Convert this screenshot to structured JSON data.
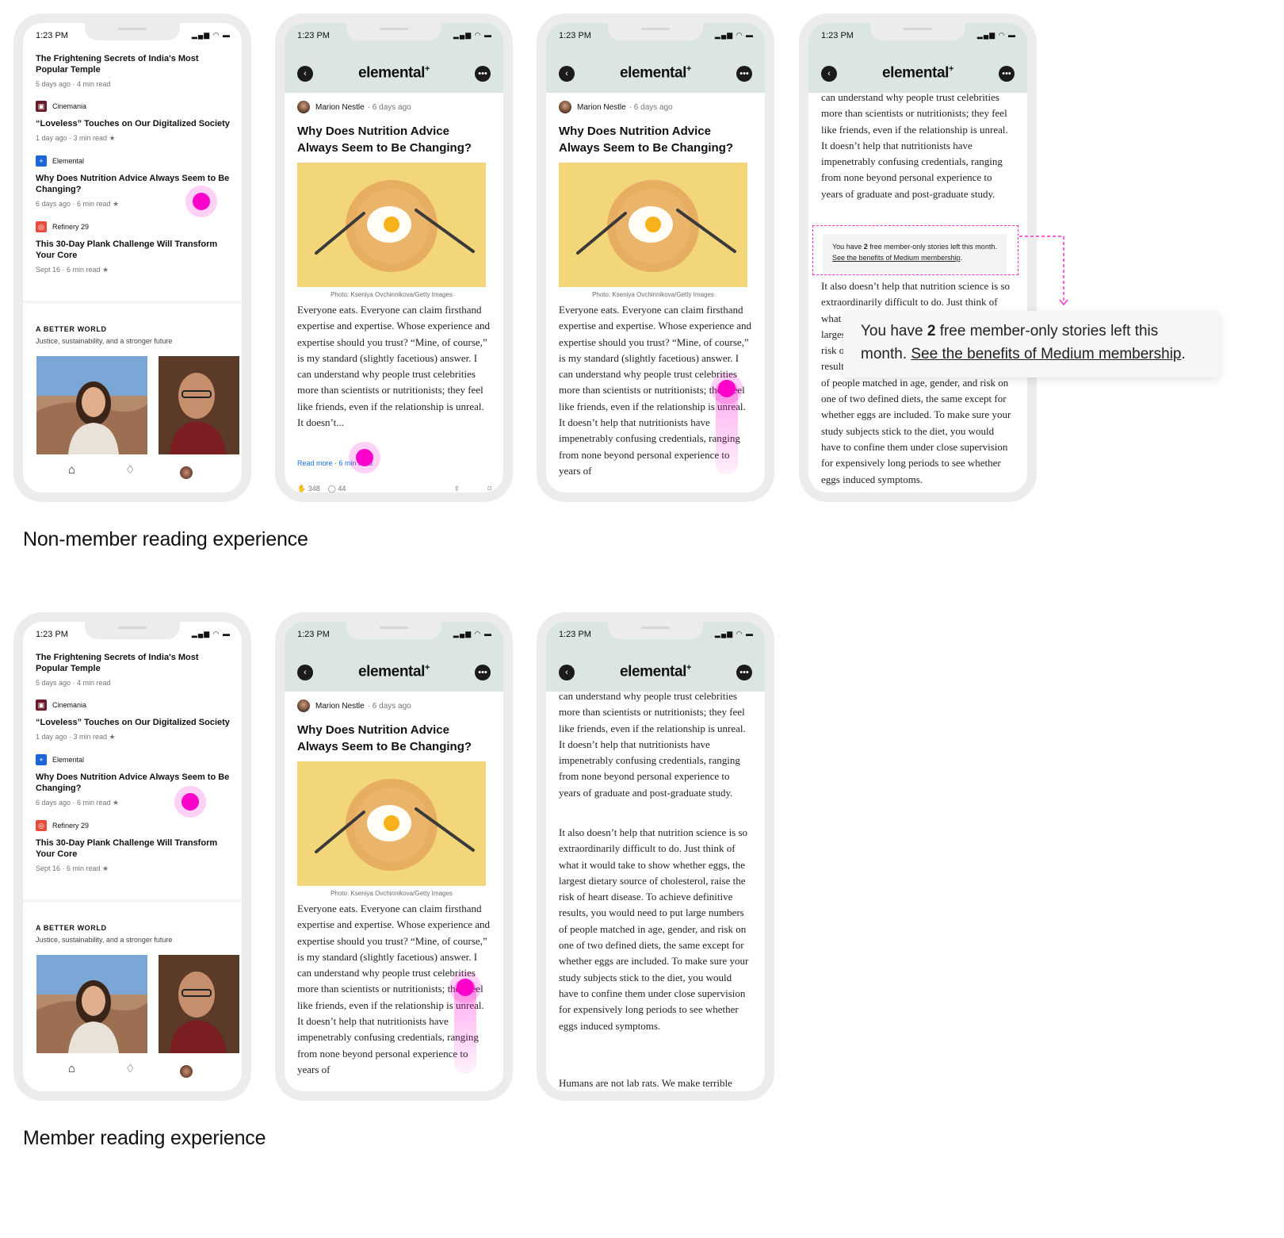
{
  "status": {
    "time": "1:23 PM",
    "signal_icon": "signal-wifi-battery-icon"
  },
  "feed": {
    "items": [
      {
        "publication": "",
        "title": "The Frightening Secrets of India's Most Popular Temple",
        "meta": "5 days ago · 4 min read"
      },
      {
        "publication": "Cinemania",
        "title": "“Loveless” Touches on Our Digitalized Society",
        "meta": "1 day ago · 3 min read ★"
      },
      {
        "publication": "Elemental",
        "title": "Why Does Nutrition Advice Always Seem to Be Changing?",
        "meta": "6 days ago · 6 min read ★"
      },
      {
        "publication": "Refinery 29",
        "title": "This 30-Day Plank Challenge Will Transform Your Core",
        "meta": "Sept 16 · 6 min read ★"
      }
    ],
    "section_title": "A BETTER WORLD",
    "section_subtitle": "Justice, sustainability, and a stronger future"
  },
  "article": {
    "brand": "elemental",
    "brand_mark": "+",
    "author": "Marion Nestle",
    "ago": "· 6 days ago",
    "title": "Why Does Nutrition Advice Always Seem to Be Changing?",
    "caption": "Photo: Kseniya Ovchinnikova/Getty Images",
    "p1": "Everyone eats. Everyone can claim firsthand expertise and expertise. Whose experience and expertise should you trust? “Mine, of course,” is my standard (slightly facetious) answer. I can understand why people trust celebrities more than scientists or nutritionists; they feel like friends, even if the relationship is unreal. It doesn’t help that nutritionists have impenetrably confusing credentials, ranging from none beyond personal experience to years of",
    "p1_truncated": "Everyone eats. Everyone can claim firsthand expertise and expertise. Whose experience and expertise should you trust? “Mine, of course,” is my standard (slightly facetious) answer. I can understand why people trust celebrities more than scientists or nutritionists; they feel like friends, even if the relationship is unreal. It doesn’t...",
    "read_more": "Read more · 6 min read",
    "claps": "348",
    "responses": "44",
    "scrolled_p1": "can understand why people trust celebrities more than scientists or nutritionists; they feel like friends, even if the relationship is unreal. It doesn’t help that nutritionists have impenetrably confusing credentials, ranging from none beyond personal experience to years of graduate and post-graduate study.",
    "p2": "It also doesn’t help that nutrition science is so extraordinarily difficult to do. Just think of what it would take to show whether eggs, the largest dietary source of cholesterol, raise the risk of heart disease. To achieve definitive results, you would need to put large numbers of people matched in age, gender, and risk on one of two defined diets, the same except for whether eggs are included. To make sure your study subjects stick to the diet, you would have to confine them under close supervision for expensively long periods to see whether eggs induced symptoms.",
    "p3": "Humans are not lab rats. We make terrible experimental animals. This forces"
  },
  "paywall": {
    "pre": "You have",
    "count": "2",
    "post": "free member-only stories left this month.",
    "link": "See the benefits of Medium membership"
  },
  "labels": {
    "nonmember": "Non-member reading experience",
    "member": "Member reading experience"
  },
  "colors": {
    "accent": "#ff00cc",
    "appbar": "#dbe6e3",
    "hero": "#f2d679"
  }
}
